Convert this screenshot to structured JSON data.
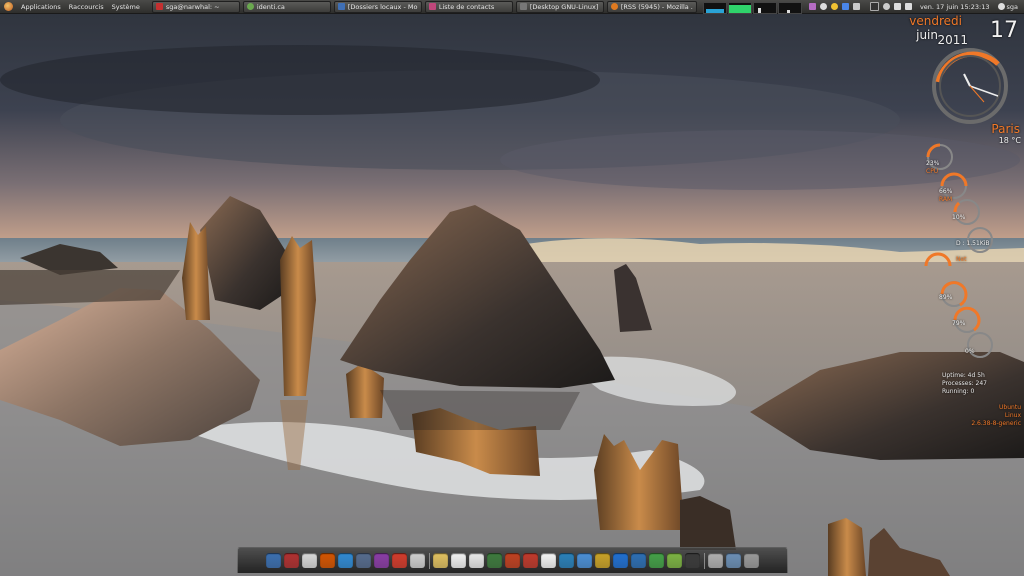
{
  "panel": {
    "menus": [
      "Applications",
      "Raccourcis",
      "Système"
    ],
    "tasks": [
      {
        "label": "sga@narwhal: ~",
        "color": "#c43030"
      },
      {
        "label": "identi.ca",
        "color": "#6aa84f"
      },
      {
        "label": "[Dossiers locaux - Mo...",
        "color": "#3f6fb5"
      },
      {
        "label": "Liste de contacts",
        "color": "#c0477b"
      },
      {
        "label": "[Desktop GNU-Linux]",
        "color": "#777777"
      },
      {
        "label": "[RSS (5945) - Mozilla ...",
        "color": "#e07a20"
      }
    ],
    "clock": "ven. 17 juin 15:23:13",
    "user": "sga"
  },
  "conky": {
    "day_name": "vendredi",
    "month": "juin",
    "year": "2011",
    "date": "17",
    "city": "Paris",
    "temperature": "18 °C",
    "gauges": [
      {
        "value_label": "23%",
        "name": "CPU",
        "value": 0.23
      },
      {
        "value_label": "66%",
        "name": "RAM",
        "value": 0.66
      },
      {
        "value_label": "10%",
        "name": "",
        "value": 0.1
      },
      {
        "value_label": "D : 1.51KiB",
        "name": "",
        "value": 0.05
      },
      {
        "value_label": "",
        "name": "Net",
        "value": 0.6
      },
      {
        "value_label": "89%",
        "name": "",
        "value": 0.89
      },
      {
        "value_label": "79%",
        "name": "",
        "value": 0.79
      },
      {
        "value_label": "0%",
        "name": "",
        "value": 0.0
      }
    ],
    "uptime": "Uptime: 4d 5h",
    "processes": "Processes: 247",
    "running": "Running: 0",
    "sys_lines": [
      "Ubuntu",
      "Linux",
      "2.6.38-8-generic"
    ]
  },
  "dock": {
    "icons": [
      "#3b6fb0",
      "#b03030",
      "#d8d8d8",
      "#d35400",
      "#2f8ad3",
      "#556b8d",
      "#8a3ca5",
      "#d23b2b",
      "#cfcfcf",
      "#e0c060",
      "#f2f2f2",
      "#e8e8e8",
      "#3d7a3d",
      "#c04020",
      "#c0392b",
      "#f5f5f5",
      "#2980b9",
      "#4a8fd6",
      "#c9a227",
      "#1f6fd1",
      "#2c6eb3",
      "#43a047",
      "#7cb342",
      "#3a3a3a",
      "#b0b0b0",
      "#6b8fb5",
      "#9a9a9a"
    ]
  },
  "colors": {
    "accent": "#f07828"
  }
}
